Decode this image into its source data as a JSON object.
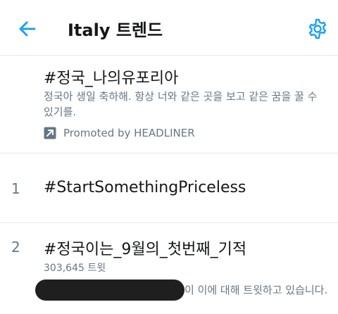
{
  "header": {
    "title": "Italy 트렌드",
    "back_icon": "arrow-left-icon",
    "settings_icon": "gear-icon",
    "accent_color": "#1da1f2"
  },
  "trends": {
    "promoted": {
      "tag": "#정국_나의유포리아",
      "desc_line1": "정국아 생일 축하해. 항상 너와 같은 곳을 보고 같은 꿈을 꿀 수",
      "desc_line2": "있기를.",
      "promoted_label": "Promoted by HEADLINER",
      "promoted_icon": "promoted-arrow-icon"
    },
    "items": [
      {
        "rank": "1",
        "tag": "#StartSomethingPriceless"
      },
      {
        "rank": "2",
        "tag": "#정국이는_9월의_첫번째_기적",
        "count": "303,645 트윗",
        "context": "이 이에 대해 트윗하고 있습니다."
      }
    ]
  }
}
